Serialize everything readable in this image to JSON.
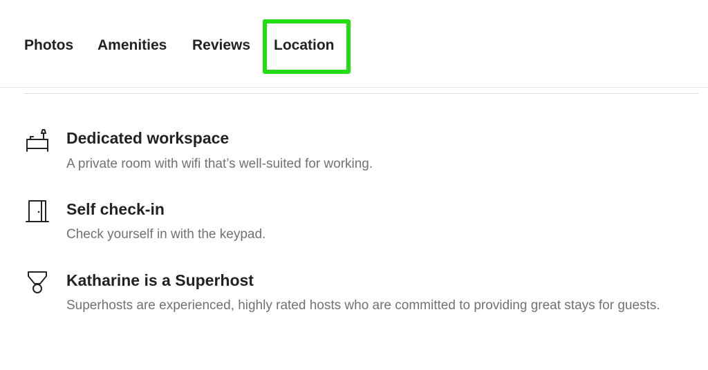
{
  "nav": {
    "tabs": [
      {
        "label": "Photos"
      },
      {
        "label": "Amenities"
      },
      {
        "label": "Reviews"
      },
      {
        "label": "Location"
      }
    ],
    "highlighted_tab": "Location",
    "highlight_color": "#22dd11"
  },
  "features": [
    {
      "icon": "desk-workspace-icon",
      "title": "Dedicated workspace",
      "description": "A private room with wifi that’s well-suited for working."
    },
    {
      "icon": "door-icon",
      "title": "Self check-in",
      "description": "Check yourself in with the keypad."
    },
    {
      "icon": "superhost-medal-icon",
      "title": "Katharine is a Superhost",
      "description": "Superhosts are experienced, highly rated hosts who are committed to providing great stays for guests."
    }
  ],
  "colors": {
    "text_primary": "#222222",
    "text_secondary": "#717171",
    "divider": "#dddddd"
  }
}
